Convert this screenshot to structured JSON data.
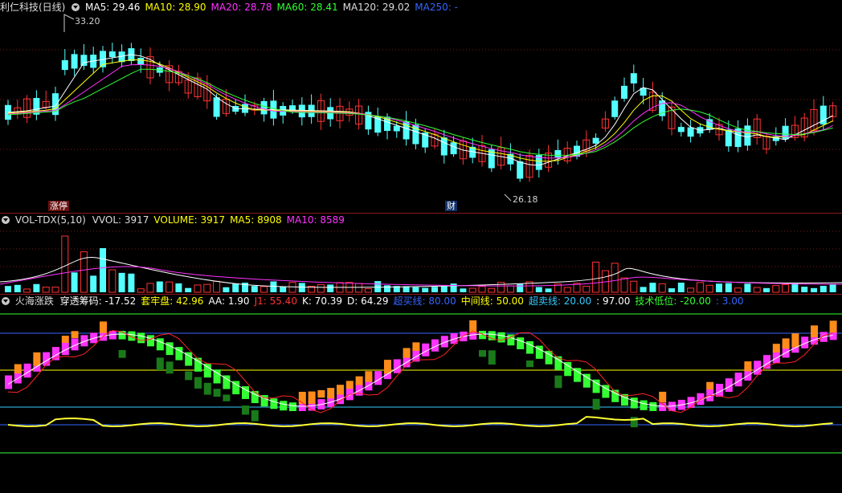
{
  "main": {
    "title": "利仁科技(日线)",
    "ma": [
      {
        "label": "MA5: 29.46",
        "color": "#ffffff"
      },
      {
        "label": "MA10: 28.90",
        "color": "#ffff00"
      },
      {
        "label": "MA20: 28.78",
        "color": "#ff33ff"
      },
      {
        "label": "MA60: 28.41",
        "color": "#33ff33"
      },
      {
        "label": "MA120: 29.02",
        "color": "#dddddd"
      },
      {
        "label": "MA250: -",
        "color": "#3366ff"
      }
    ],
    "high_label": "33.20",
    "low_label": "26.18",
    "tag_zhangting": "涨停",
    "tag_cai": "财"
  },
  "volume": {
    "title": "VOL-TDX(5,10)",
    "items": [
      {
        "label": "VVOL: 3917",
        "color": "#dddddd"
      },
      {
        "label": "VOLUME: 3917",
        "color": "#ffff00"
      },
      {
        "label": "MA5: 8908",
        "color": "#ffff00"
      },
      {
        "label": "MA10: 8589",
        "color": "#ff33ff"
      }
    ]
  },
  "indicator": {
    "title": "火海涨跌",
    "items": [
      {
        "label": "穿透筹码: -17.52",
        "color": "#ffffff"
      },
      {
        "label": "套牢盘: 42.96",
        "color": "#ffff00"
      },
      {
        "label": "AA: 1.90",
        "color": "#ffffff"
      },
      {
        "label": "J1: 55.40",
        "color": "#ff3333"
      },
      {
        "label": "K: 70.39",
        "color": "#ffffff"
      },
      {
        "label": "D: 64.29",
        "color": "#ffffff"
      },
      {
        "label": "超买线: 80.00",
        "color": "#3366ff"
      },
      {
        "label": "中间线: 50.00",
        "color": "#ffff00"
      },
      {
        "label": "超卖线: 20.00",
        "color": "#33ccff"
      },
      {
        "label": ": 97.00",
        "color": "#ffffff"
      },
      {
        "label": "技术低位: -20.00",
        "color": "#33ff33"
      },
      {
        "label": ": 3.00",
        "color": "#3366ff"
      }
    ]
  },
  "colors": {
    "up": "#ff3333",
    "down": "#54ffff",
    "grid": "#8a1a1a"
  }
}
